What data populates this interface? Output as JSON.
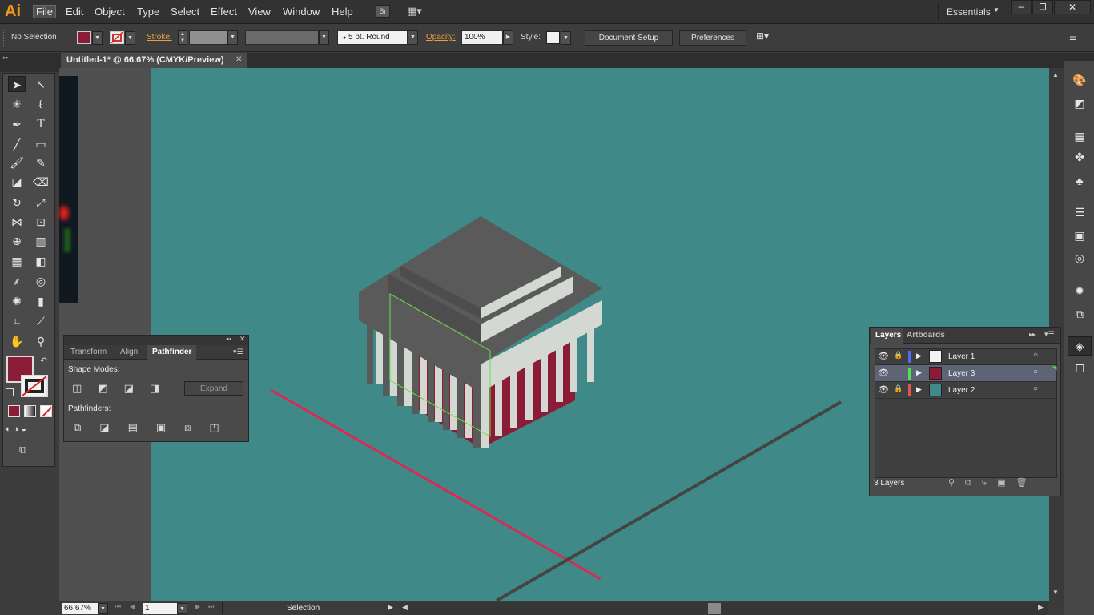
{
  "app": {
    "logo": "Ai"
  },
  "menu": [
    "File",
    "Edit",
    "Object",
    "Type",
    "Select",
    "Effect",
    "View",
    "Window",
    "Help"
  ],
  "bridge_label": "Br",
  "workspace": "Essentials",
  "control": {
    "selection": "No Selection",
    "stroke_label": "Stroke:",
    "brush": "5 pt. Round",
    "opacity_label": "Opacity:",
    "opacity_value": "100%",
    "style_label": "Style:",
    "doc_setup": "Document Setup",
    "preferences": "Preferences"
  },
  "document": {
    "tab_title": "Untitled-1* @ 66.67% (CMYK/Preview)"
  },
  "pathfinder": {
    "tabs": [
      "Transform",
      "Align",
      "Pathfinder"
    ],
    "shape_modes_label": "Shape Modes:",
    "expand_label": "Expand",
    "pathfinders_label": "Pathfinders:"
  },
  "layers_panel": {
    "tabs": [
      "Layers",
      "Artboards"
    ],
    "layers": [
      {
        "name": "Layer 1",
        "color": "#4f6bf5",
        "locked": true
      },
      {
        "name": "Layer 3",
        "color": "#4ee34e",
        "locked": false,
        "selected": true
      },
      {
        "name": "Layer 2",
        "color": "#e25555",
        "locked": true
      }
    ],
    "count_label": "3 Layers"
  },
  "status": {
    "zoom": "66.67%",
    "page": "1",
    "mode": "Selection"
  },
  "colors": {
    "fill": "#8a1c35",
    "canvas": "#3f8a88",
    "accent_orange": "#e8a23a"
  }
}
